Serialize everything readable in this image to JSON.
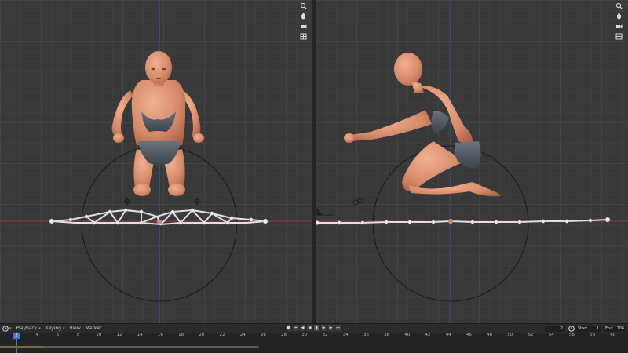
{
  "timeline": {
    "menu": {
      "playback": "Playback",
      "keying": "Keying",
      "view": "View",
      "marker": "Marker"
    },
    "current_frame": "2",
    "start_label": "Start",
    "start_value": "1",
    "end_label": "End",
    "end_value": "106",
    "ruler_labels": [
      "2",
      "4",
      "6",
      "8",
      "10",
      "12",
      "14",
      "16",
      "18",
      "20",
      "22",
      "24",
      "26",
      "28",
      "30",
      "32",
      "34",
      "36",
      "38",
      "40",
      "42",
      "44",
      "46",
      "48",
      "50",
      "52",
      "54",
      "56",
      "58",
      "60"
    ],
    "playhead_label": "2"
  },
  "icons": {
    "nav": [
      "zoom-icon",
      "hand-pan-icon",
      "camera-view-icon",
      "grid-view-icon"
    ],
    "transport": [
      "jump-start-icon",
      "prev-keyframe-icon",
      "play-reverse-icon",
      "play-icon",
      "next-keyframe-icon",
      "jump-end-icon"
    ]
  },
  "colors": {
    "viewport_bg": "#393939",
    "x_axis": "#9b3a3a",
    "z_axis": "#3a5a9b",
    "skin": "#d89070",
    "clothing": "#505862",
    "rig": "#dcdcdc",
    "accent": "#4a77c9"
  }
}
